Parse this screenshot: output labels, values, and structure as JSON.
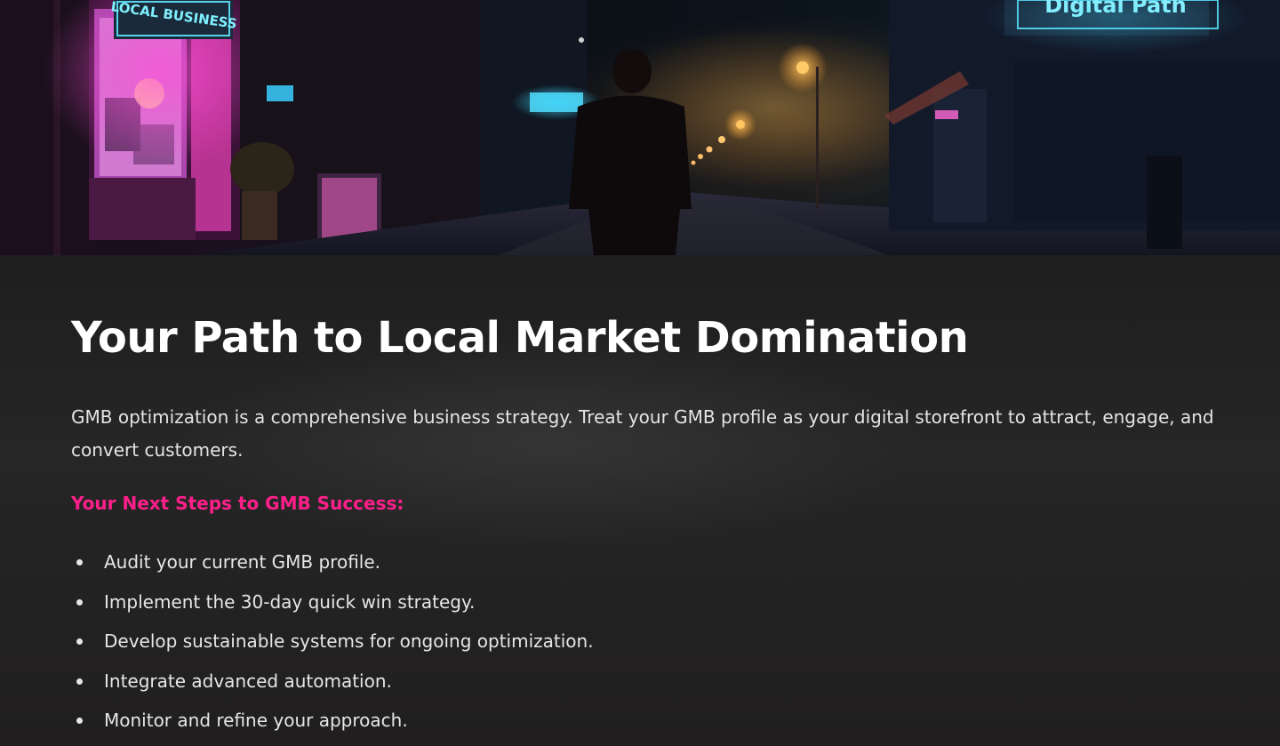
{
  "hero": {
    "image": "night-street-neon-storefront",
    "sign_left": "LOCAL BUSINESS",
    "sign_right": "Digital Path"
  },
  "section": {
    "title": "Your Path to Local Market Domination",
    "intro": "GMB optimization is a comprehensive business strategy. Treat your GMB profile as your digital storefront to attract, engage, and convert customers.",
    "subheading": "Your Next Steps to GMB Success:",
    "steps": [
      "Audit your current GMB profile.",
      "Implement the 30-day quick win strategy.",
      "Develop sustainable systems for ongoing optimization.",
      "Integrate advanced automation.",
      "Monitor and refine your approach."
    ]
  },
  "colors": {
    "background": "#222222",
    "heading": "#ffffff",
    "accent_pink": "#ff1f8a",
    "body_text": "#e4e4e4"
  }
}
